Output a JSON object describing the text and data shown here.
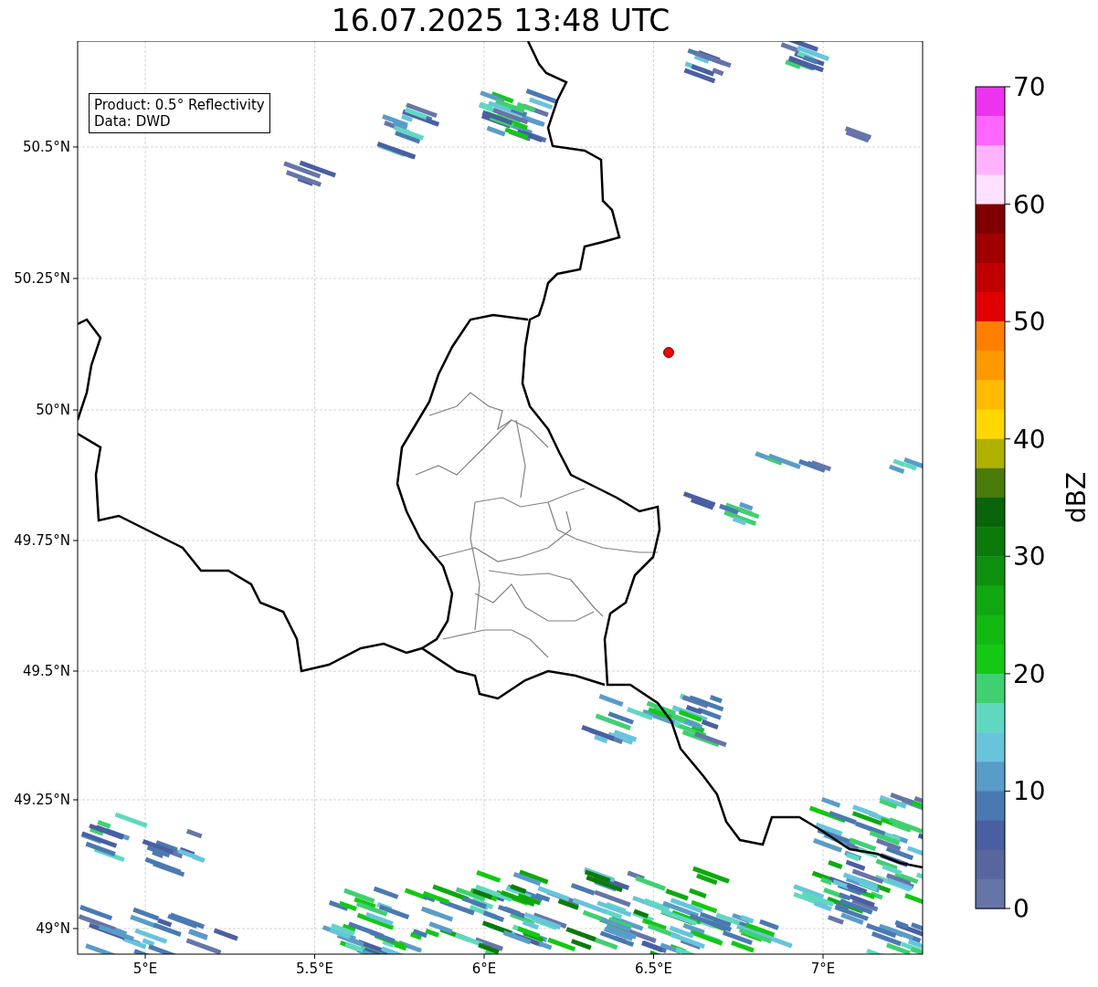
{
  "title": "16.07.2025 13:48 UTC",
  "info_box": {
    "lines": [
      "Product: 0.5° Reflectivity",
      "Data: DWD"
    ]
  },
  "map": {
    "lon_ticks": [
      "5°E",
      "5.5°E",
      "6°E",
      "6.5°E",
      "7°E"
    ],
    "lat_ticks": [
      "50.5°N",
      "50.25°N",
      "50°N",
      "49.75°N",
      "49.5°N",
      "49.25°N",
      "49°N"
    ]
  },
  "colorbar": {
    "label": "dBZ",
    "ticks": [
      "70",
      "60",
      "50",
      "40",
      "30",
      "20",
      "10",
      "0"
    ],
    "bins": [
      {
        "color": "#ee33ee"
      },
      {
        "color": "#ff66ff"
      },
      {
        "color": "#ffb3ff"
      },
      {
        "color": "#ffe0ff"
      },
      {
        "color": "#800000"
      },
      {
        "color": "#a00000"
      },
      {
        "color": "#c00000"
      },
      {
        "color": "#e00000"
      },
      {
        "color": "#ff7f00"
      },
      {
        "color": "#ff9900"
      },
      {
        "color": "#ffbb00"
      },
      {
        "color": "#ffd700"
      },
      {
        "color": "#b0b000"
      },
      {
        "color": "#4a7a0a"
      },
      {
        "color": "#0a650a"
      },
      {
        "color": "#0b7a0b"
      },
      {
        "color": "#0e8f0e"
      },
      {
        "color": "#10a810"
      },
      {
        "color": "#12b812"
      },
      {
        "color": "#14c814"
      },
      {
        "color": "#40d070"
      },
      {
        "color": "#60d8c0"
      },
      {
        "color": "#68c4dc"
      },
      {
        "color": "#5a9cc8"
      },
      {
        "color": "#4a79b2"
      },
      {
        "color": "#4a5fa2"
      },
      {
        "color": "#5866a0"
      },
      {
        "color": "#6675a8"
      }
    ]
  }
}
